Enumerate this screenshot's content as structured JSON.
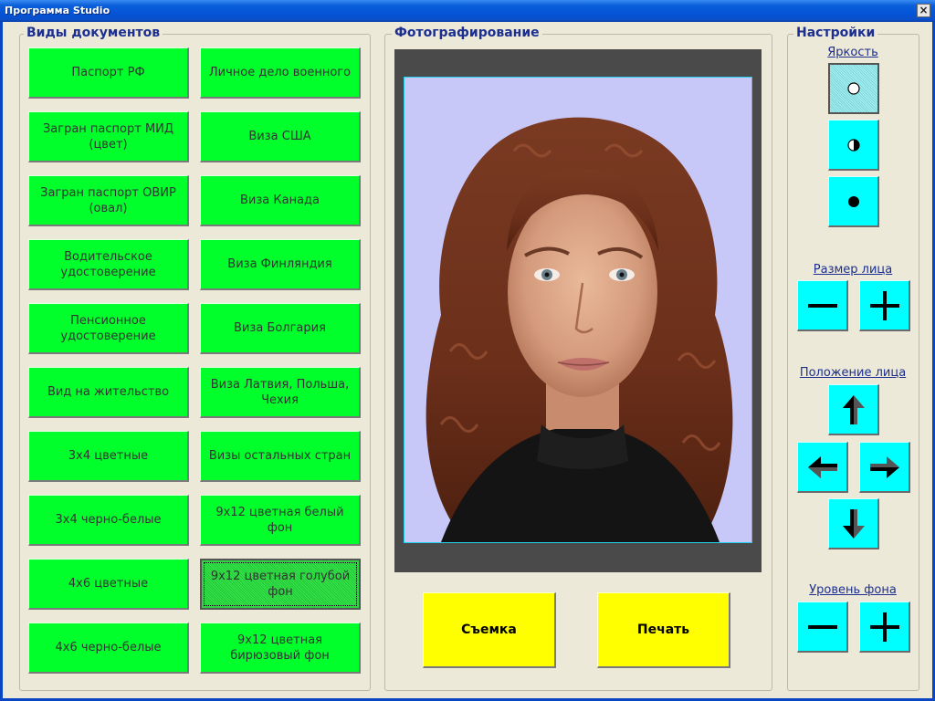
{
  "window": {
    "title": "Программа Studio",
    "close_glyph": "×"
  },
  "documents": {
    "label": "Виды документов",
    "buttons": [
      "Паспорт РФ",
      "Личное дело военного",
      "Загран паспорт МИД\n(цвет)",
      "Виза США",
      "Загран паспорт ОВИР\n(овал)",
      "Виза Канада",
      "Водительское\nудостоверение",
      "Виза Финляндия",
      "Пенсионное\nудостоверение",
      "Виза Болгария",
      "Вид на жительство",
      "Виза Латвия, Польша,\nЧехия",
      "3х4 цветные",
      "Визы остальных стран",
      "3х4 черно-белые",
      "9х12 цветная белый\nфон",
      "4х6 цветные",
      "9х12 цветная голубой\nфон",
      "4х6 черно-белые",
      "9х12 цветная\nбирюзовый фон"
    ],
    "selected_index": 17
  },
  "photo": {
    "label": "Фотографирование",
    "shoot_label": "Съемка",
    "print_label": "Печать",
    "background_color": "#c8c8f8"
  },
  "settings": {
    "label": "Настройки",
    "brightness": {
      "label": "Яркость",
      "icons": [
        "brightness-high-icon",
        "brightness-medium-icon",
        "brightness-low-icon"
      ],
      "selected_index": 0
    },
    "face_size": {
      "label": "Размер лица",
      "icons": [
        "minus-icon",
        "plus-icon"
      ]
    },
    "face_position": {
      "label": "Положение лица",
      "icons": [
        "arrow-up-icon",
        "arrow-left-icon",
        "arrow-right-icon",
        "arrow-down-icon"
      ]
    },
    "background_level": {
      "label": "Уровень фона",
      "icons": [
        "minus-icon",
        "plus-icon"
      ]
    }
  },
  "colors": {
    "doc_button": "#00ff2b",
    "action_button": "#ffff00",
    "settings_button": "#00ffff",
    "label_text": "#1c2f90",
    "titlebar": "#0454d8"
  }
}
